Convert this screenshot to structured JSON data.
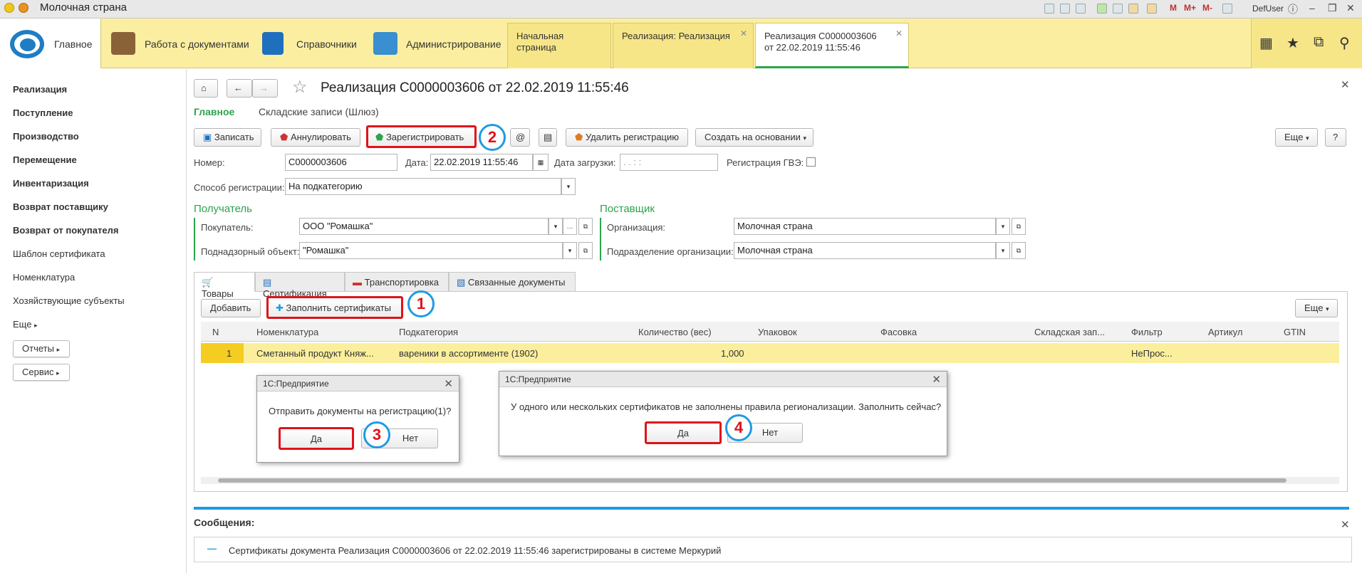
{
  "titlebar": {
    "title": "Молочная страна",
    "user": "DefUser",
    "m1": "M",
    "m2": "M+",
    "m3": "M-"
  },
  "nav": {
    "home": "Главное",
    "sections": [
      "Работа с документами",
      "Справочники",
      "Администрирование"
    ],
    "tabs": [
      "Начальная страница",
      "Реализация: Реализация",
      "Реализация С0000003606 от 22.02.2019 11:55:46"
    ]
  },
  "sidebar": {
    "items": [
      "Реализация",
      "Поступление",
      "Производство",
      "Перемещение",
      "Инвентаризация",
      "Возврат поставщику",
      "Возврат от покупателя",
      "Шаблон сертификата",
      "Номенклатура",
      "Хозяйствующие субъекты",
      "Еще"
    ],
    "buttons": [
      "Отчеты",
      "Сервис"
    ]
  },
  "doc": {
    "title": "Реализация С0000003606 от 22.02.2019 11:55:46",
    "subtabs": [
      "Главное",
      "Складские записи (Шлюз)"
    ],
    "toolbar": {
      "save": "Записать",
      "cancel": "Аннулировать",
      "register": "Зарегистрировать",
      "at": "@",
      "delete_reg": "Удалить регистрацию",
      "create_based": "Создать на основании",
      "more": "Еще",
      "help": "?"
    },
    "fields": {
      "number_label": "Номер:",
      "number": "С0000003606",
      "date_label": "Дата:",
      "date": "22.02.2019 11:55:46",
      "load_date_label": "Дата загрузки:",
      "load_date": " .  .       :  :",
      "gvz_label": "Регистрация ГВЭ:",
      "reg_method_label": "Способ регистрации:",
      "reg_method": "На подкатегорию"
    },
    "recipient": {
      "title": "Получатель",
      "buyer_label": "Покупатель:",
      "buyer": "ООО \"Ромашка\"",
      "object_label": "Поднадзорный объект:",
      "object": "\"Ромашка\""
    },
    "supplier": {
      "title": "Поставщик",
      "org_label": "Организация:",
      "org": "Молочная страна",
      "dept_label": "Подразделение организации:",
      "dept": "Молочная страна"
    },
    "panel_tabs": [
      "Товары",
      "Сертификация",
      "Транспортировка",
      "Связанные документы"
    ],
    "panel_toolbar": {
      "add": "Добавить",
      "fill": "Заполнить сертификаты",
      "more": "Еще"
    },
    "grid": {
      "headers": [
        "N",
        "Номенклатура",
        "Подкатегория",
        "Количество (вес)",
        "Упаковок",
        "Фасовка",
        "Складская зап...",
        "Фильтр",
        "Артикул",
        "GTIN"
      ],
      "rows": [
        [
          "1",
          "Сметанный продукт Княж...",
          "вареники в ассортименте (1902)",
          "1,000",
          "",
          "",
          "",
          "НеПрос...",
          "",
          ""
        ]
      ]
    }
  },
  "dialogs": [
    {
      "title": "1С:Предприятие",
      "text": "Отправить документы на регистрацию(1)?",
      "yes": "Да",
      "no": "Нет"
    },
    {
      "title": "1С:Предприятие",
      "text": "У одного или нескольких сертификатов не заполнены правила регионализации. Заполнить сейчас?",
      "yes": "Да",
      "no": "Нет"
    }
  ],
  "callouts": [
    "1",
    "2",
    "3",
    "4"
  ],
  "messages": {
    "title": "Сообщения:",
    "items": [
      "Сертификаты документа Реализация С0000003606 от 22.02.2019 11:55:46 зарегистрированы в системе Меркурий"
    ]
  },
  "colors": {
    "accent_green": "#2ca44c",
    "highlight_red": "#e0121b",
    "callout_blue": "#1f9ae2",
    "nav_yellow": "#fbeea0"
  }
}
